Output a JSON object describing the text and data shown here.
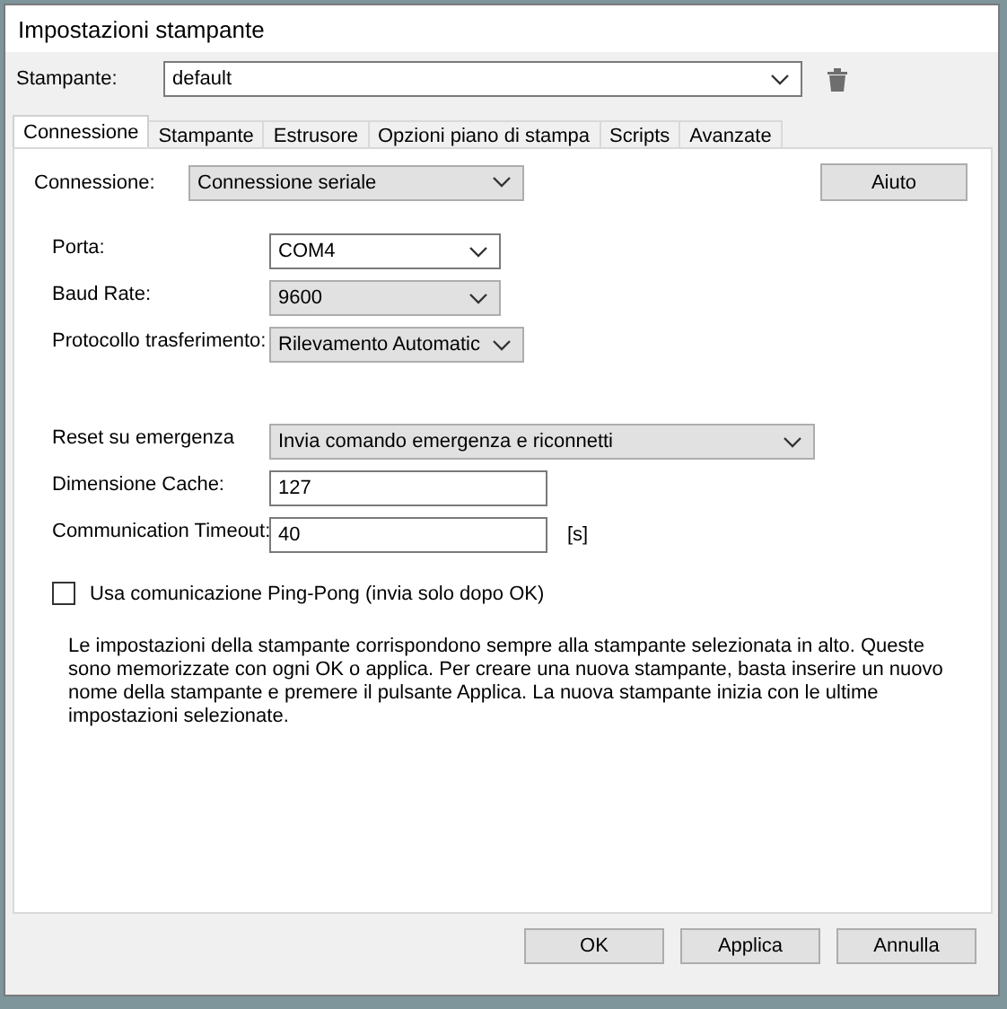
{
  "window": {
    "title": "Impostazioni stampante"
  },
  "printer": {
    "label": "Stampante:",
    "kind": "combo",
    "value": "default"
  },
  "tabs": [
    {
      "label": "Connessione",
      "selected": true
    },
    {
      "label": "Stampante",
      "selected": false
    },
    {
      "label": "Estrusore",
      "selected": false
    },
    {
      "label": "Opzioni piano di stampa",
      "selected": false
    },
    {
      "label": "Scripts",
      "selected": false
    },
    {
      "label": "Avanzate",
      "selected": false
    }
  ],
  "connection": {
    "label": "Connessione:",
    "kind": "dropdown",
    "value": "Connessione seriale",
    "help_button": "Aiuto"
  },
  "serial_fields": [
    {
      "label": "Porta:",
      "kind": "combo",
      "value": "COM4"
    },
    {
      "label": "Baud Rate:",
      "kind": "dropdown",
      "value": "9600"
    },
    {
      "label": "Protocollo trasferimento:",
      "kind": "dropdown",
      "value": "Rilevamento Automatic"
    }
  ],
  "advanced_fields": [
    {
      "label": "Reset su emergenza",
      "kind": "dropdown",
      "value": "Invia comando emergenza e riconnetti",
      "wide": true
    },
    {
      "label": "Dimensione Cache:",
      "kind": "text",
      "value": "127"
    },
    {
      "label": "Communication Timeout:",
      "kind": "text",
      "value": "40",
      "unit": "[s]"
    }
  ],
  "ping_pong": {
    "label": "Usa comunicazione Ping-Pong (invia solo dopo OK)",
    "checked": false
  },
  "note": "Le impostazioni della stampante corrispondono sempre alla stampante selezionata in alto. Queste sono memorizzate con ogni OK o applica. Per creare una nuova stampante, basta inserire un nuovo nome della stampante e premere il pulsante Applica. La nuova stampante inizia con le ultime impostazioni selezionate.",
  "buttons": [
    "OK",
    "Applica",
    "Annulla"
  ]
}
